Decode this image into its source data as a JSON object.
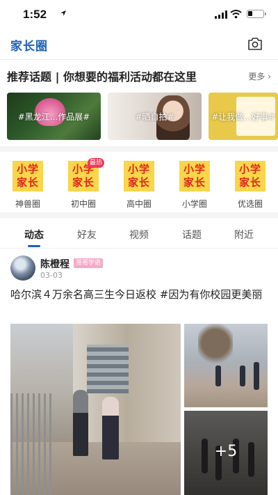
{
  "status_bar": {
    "time": "1:52"
  },
  "nav": {
    "title": "家长圈"
  },
  "topics": {
    "title": "推荐话题 | 你想要的福利活动都在这里",
    "more": "更多 ›",
    "cards": [
      {
        "label": "#黑龙江...作品展#"
      },
      {
        "label": "#晒自拍#"
      },
      {
        "label": "#让我做...好事#",
        "note": "让我做你\n做好事"
      }
    ]
  },
  "categories": {
    "logo_text": "小学\n家长",
    "hot_badge": "最热",
    "items": [
      {
        "label": "神兽圈"
      },
      {
        "label": "初中圈"
      },
      {
        "label": "高中圈"
      },
      {
        "label": "小学圈"
      },
      {
        "label": "优选圈"
      }
    ]
  },
  "tabs": [
    {
      "label": "动态"
    },
    {
      "label": "好友"
    },
    {
      "label": "视频"
    },
    {
      "label": "话题"
    },
    {
      "label": "附近"
    }
  ],
  "post": {
    "author": "陈橙程",
    "badge": "哥哥学语",
    "date": "03-03",
    "text": "哈尔滨４万余名高三生今日返校 #因为有你校园更美丽",
    "more_count": "+5"
  },
  "colors": {
    "accent": "#1e62b5",
    "logo_bg": "#f9d64a",
    "logo_text": "#e1261c",
    "hot": "#f0385a"
  }
}
